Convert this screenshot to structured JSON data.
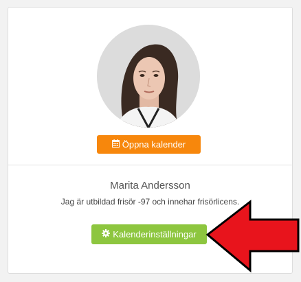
{
  "profile": {
    "open_calendar_label": "Öppna kalender",
    "name": "Marita Andersson",
    "description": "Jag är utbildad frisör -97 och innehar frisörlicens.",
    "settings_label": "Kalenderinställningar"
  },
  "icons": {
    "calendar": "calendar-icon",
    "settings": "gear-icon",
    "annotation": "red-arrow"
  },
  "colors": {
    "orange_button": "#f7870c",
    "green_button": "#8dc63f",
    "arrow": "#e8141c"
  }
}
